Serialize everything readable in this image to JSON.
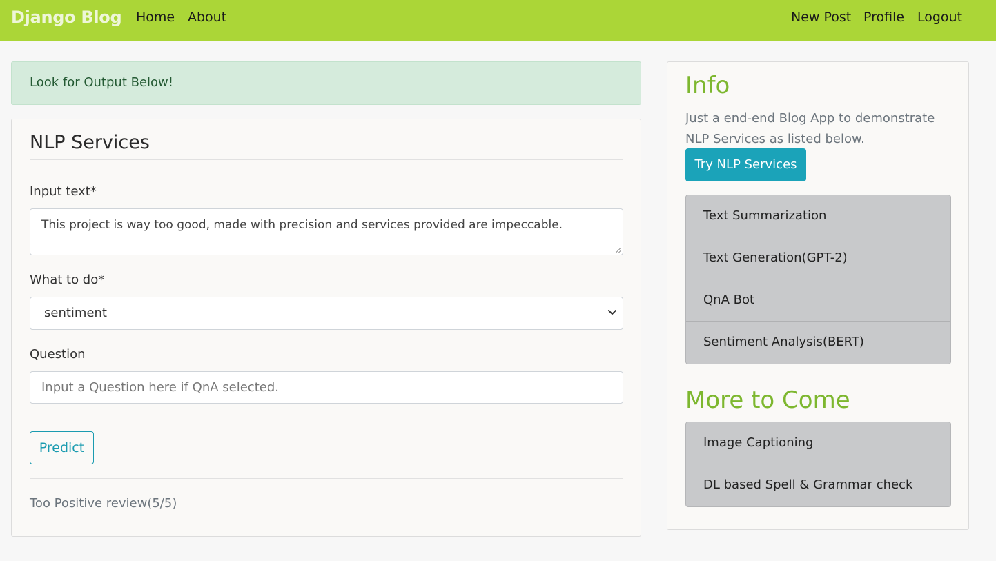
{
  "navbar": {
    "brand": "Django Blog",
    "links_left": [
      "Home",
      "About"
    ],
    "links_right": [
      "New Post",
      "Profile",
      "Logout"
    ],
    "bg_color": "#abd637"
  },
  "alert": {
    "message": "Look for Output Below!"
  },
  "form": {
    "title": "NLP Services",
    "input_text_label": "Input text*",
    "input_text_value": "This project is way too good, made with precision and services provided are impeccable.",
    "what_to_do_label": "What to do*",
    "what_to_do_value": "sentiment",
    "question_label": "Question",
    "question_placeholder": "Input a Question here if QnA selected.",
    "predict_label": "Predict",
    "output": "Too Positive review(5/5)"
  },
  "sidebar": {
    "info_heading": "Info",
    "info_text": "Just a end-end Blog App to demonstrate NLP Services as listed below.",
    "try_button": "Try NLP Services",
    "services": [
      "Text Summarization",
      "Text Generation(GPT-2)",
      "QnA Bot",
      "Sentiment Analysis(BERT)"
    ],
    "more_heading": "More to Come",
    "upcoming": [
      "Image Captioning",
      "DL based Spell & Grammar check"
    ],
    "accent_color": "#7db72f"
  }
}
